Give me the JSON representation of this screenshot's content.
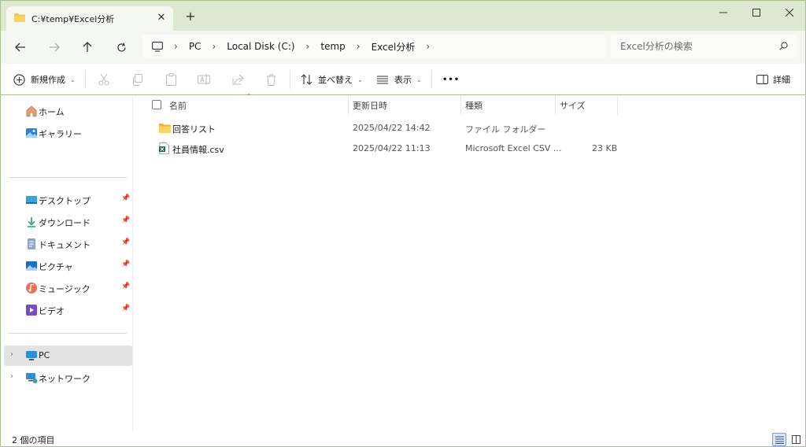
{
  "window": {
    "tab_title": "C:¥temp¥Excel分析",
    "tab_close": "✕",
    "new_tab": "+"
  },
  "nav": {
    "breadcrumb": [
      "PC",
      "Local Disk (C:)",
      "temp",
      "Excel分析"
    ],
    "search_placeholder": "Excel分析の検索"
  },
  "commands": {
    "new_label": "新規作成",
    "sort_label": "並べ替え",
    "view_label": "表示",
    "more_label": "•••",
    "details_label": "詳細"
  },
  "sidebar": {
    "top": [
      {
        "label": "ホーム",
        "icon": "home-icon"
      },
      {
        "label": "ギャラリー",
        "icon": "gallery-icon"
      }
    ],
    "quick": [
      {
        "label": "デスクトップ",
        "icon": "desktop-icon"
      },
      {
        "label": "ダウンロード",
        "icon": "download-icon"
      },
      {
        "label": "ドキュメント",
        "icon": "document-icon"
      },
      {
        "label": "ピクチャ",
        "icon": "pictures-icon"
      },
      {
        "label": "ミュージック",
        "icon": "music-icon"
      },
      {
        "label": "ビデオ",
        "icon": "video-icon"
      }
    ],
    "bottom": [
      {
        "label": "PC",
        "icon": "pc-icon",
        "selected": true
      },
      {
        "label": "ネットワーク",
        "icon": "network-icon",
        "selected": false
      }
    ]
  },
  "columns": {
    "name": "名前",
    "modified": "更新日時",
    "type": "種類",
    "size": "サイズ"
  },
  "files": [
    {
      "name": "回答リスト",
      "modified": "2025/04/22 14:42",
      "type": "ファイル フォルダー",
      "size": "",
      "icon": "folder-icon"
    },
    {
      "name": "社員情報.csv",
      "modified": "2025/04/22 11:13",
      "type": "Microsoft Excel CSV ...",
      "size": "23 KB",
      "icon": "excel-csv-icon"
    }
  ],
  "status": {
    "item_count": "2 個の項目"
  },
  "colors": {
    "titlebar_bg": "#dce8cf",
    "nav_bg": "#f5f8f1",
    "border_accent": "#a9c08e",
    "folder_yellow": "#f4c84a",
    "excel_green": "#1d7044",
    "selected_bg": "#e3e3e3"
  }
}
